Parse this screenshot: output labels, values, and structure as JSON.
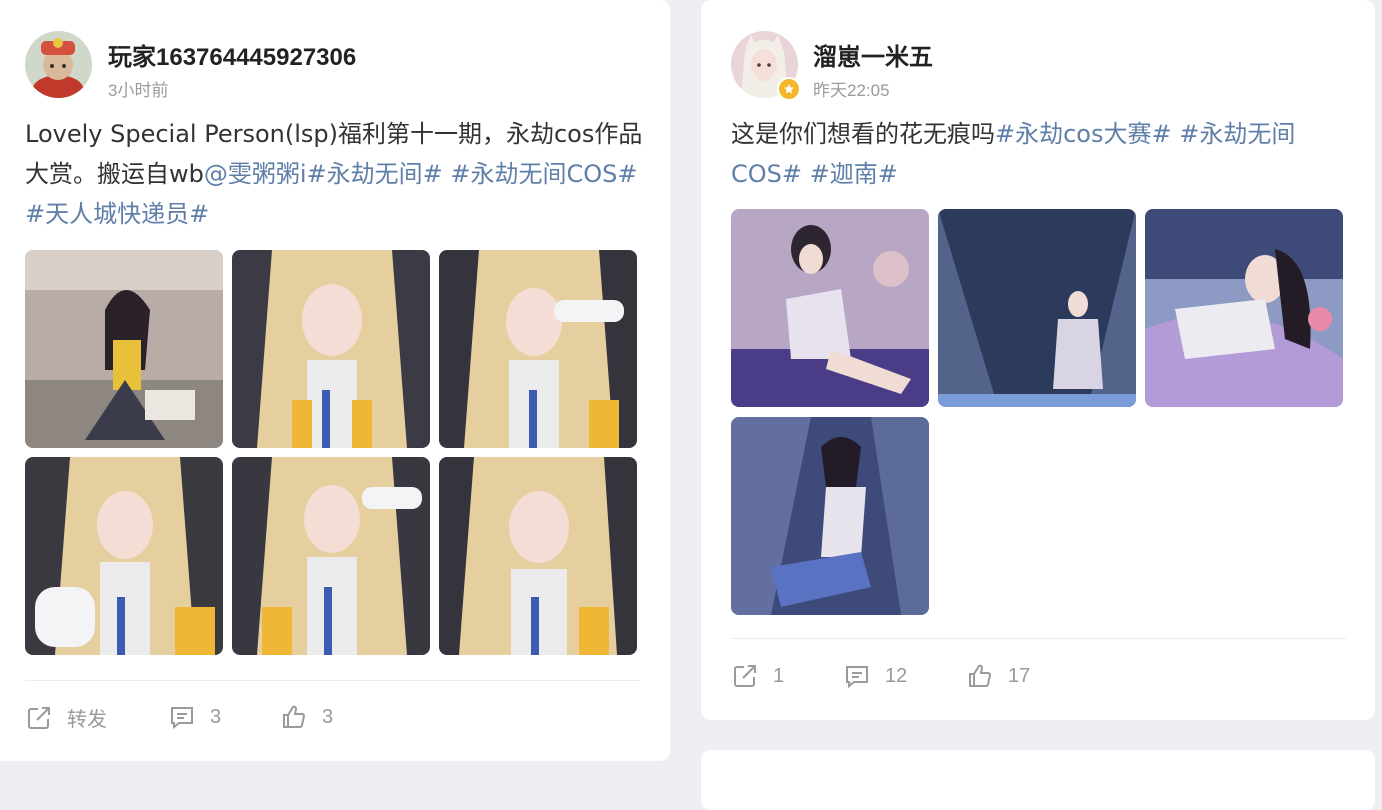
{
  "posts": [
    {
      "username": "玩家163764445927306",
      "time": "3小时前",
      "text_plain": "Lovely Special Person(lsp)福利第十一期，永劫cos作品大赏。搬运自wb",
      "text_tags": "@雯粥粥i#永劫无间# #永劫无间COS# #天人城快递员#",
      "actions": {
        "share": "转发",
        "comments": "3",
        "likes": "3"
      }
    },
    {
      "username": "溜崽一米五",
      "time": "昨天22:05",
      "text_plain": "这是你们想看的花无痕吗",
      "text_tags": "#永劫cos大赛# #永劫无间COS# #迦南#",
      "actions": {
        "share": "1",
        "comments": "12",
        "likes": "17"
      }
    }
  ],
  "colors": {
    "tag": "#5f7fa8",
    "muted": "#9a9a9a",
    "badge": "#f5b62c"
  }
}
